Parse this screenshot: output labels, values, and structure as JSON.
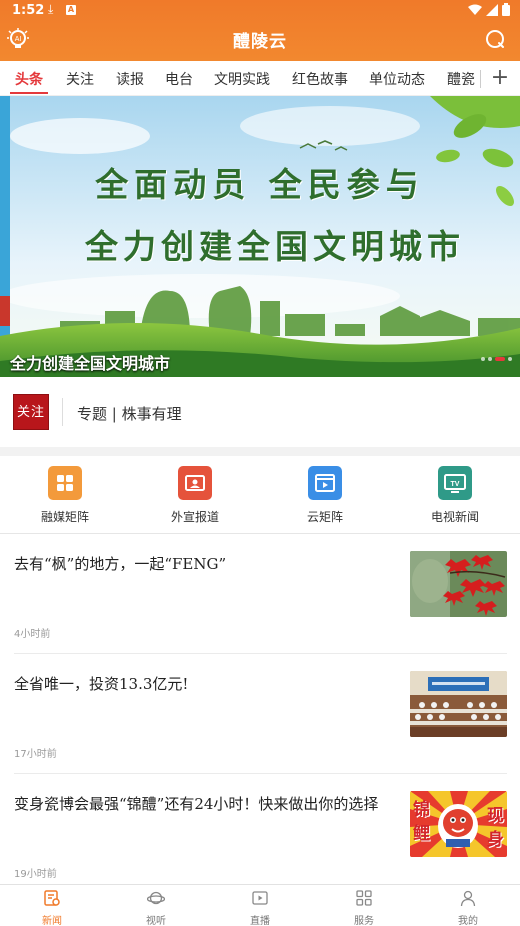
{
  "status_bar": {
    "time": "1:52"
  },
  "app_bar": {
    "title": "醴陵云"
  },
  "tabs": [
    {
      "label": "头条",
      "active": true
    },
    {
      "label": "关注"
    },
    {
      "label": "读报"
    },
    {
      "label": "电台"
    },
    {
      "label": "文明实践"
    },
    {
      "label": "红色故事"
    },
    {
      "label": "单位动态"
    },
    {
      "label": "醴瓷"
    }
  ],
  "banner": {
    "headline_1": "全面动员 全民参与",
    "headline_2": "全力创建全国文明城市",
    "caption": "全力创建全国文明城市",
    "slide_count": 4,
    "active_slide": 3
  },
  "follow": {
    "badge": "关注",
    "text": "专题 | 株事有理"
  },
  "quick_links": [
    {
      "label": "融媒矩阵",
      "icon": "grid-icon",
      "color": "#f39a3b"
    },
    {
      "label": "外宣报道",
      "icon": "report-icon",
      "color": "#e5533b"
    },
    {
      "label": "云矩阵",
      "icon": "film-icon",
      "color": "#3a8ee6"
    },
    {
      "label": "电视新闻",
      "icon": "tv-icon",
      "color": "#2f9a88"
    }
  ],
  "news": [
    {
      "title": "去有“枫”的地方，一起“FENG”",
      "time": "4小时前",
      "thumb": "red-maple-leaves"
    },
    {
      "title": "全省唯一，投资13.3亿元!",
      "time": "17小时前",
      "thumb": "conference-hall"
    },
    {
      "title": "变身瓷博会最强“锦醴”还有24小时！快来做出你的选择",
      "time": "19小时前",
      "thumb": "koi-mascot",
      "thumb_text": {
        "left_top": "锦",
        "left_bottom": "鲤",
        "right_top": "现",
        "right_bottom": "身"
      }
    }
  ],
  "bottom_nav": [
    {
      "label": "新闻",
      "icon": "news-icon",
      "active": true
    },
    {
      "label": "视听",
      "icon": "planet-icon"
    },
    {
      "label": "直播",
      "icon": "play-icon"
    },
    {
      "label": "服务",
      "icon": "apps-icon"
    },
    {
      "label": "我的",
      "icon": "person-icon"
    }
  ],
  "colors": {
    "accent": "#f07a2a",
    "tab_active": "#e4393c"
  }
}
